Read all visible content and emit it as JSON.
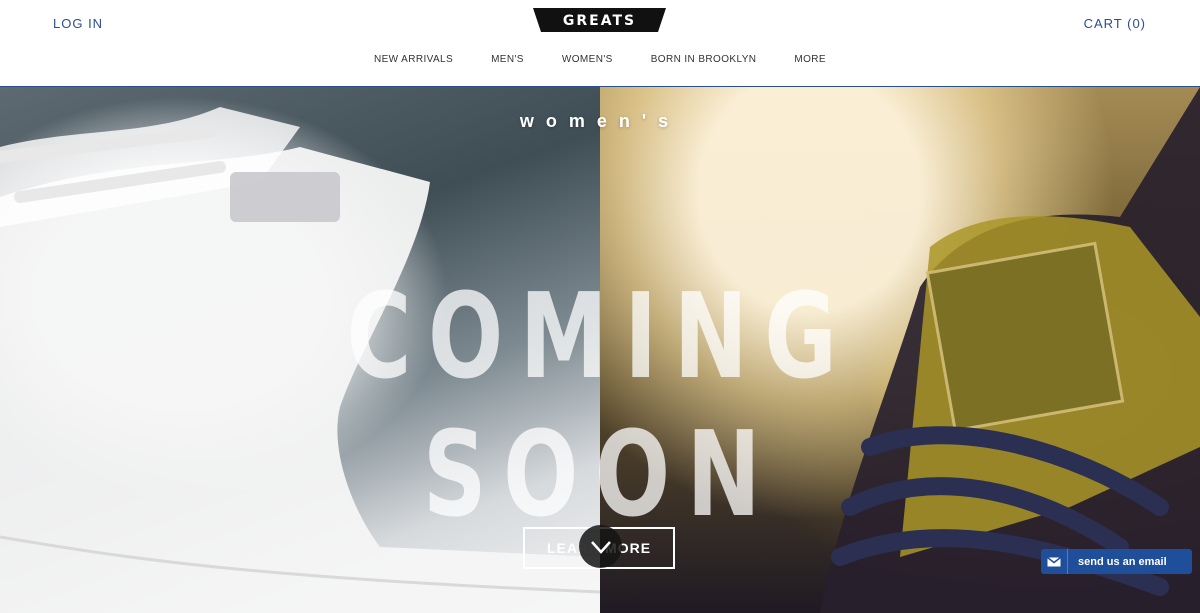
{
  "header": {
    "login_label": "LOG IN",
    "cart_label": "CART (0)",
    "logo_text": "GREATS"
  },
  "nav": {
    "items": [
      {
        "label": "NEW ARRIVALS"
      },
      {
        "label": "MEN'S"
      },
      {
        "label": "WOMEN'S"
      },
      {
        "label": "BORN IN BROOKLYN"
      },
      {
        "label": "MORE"
      }
    ]
  },
  "hero": {
    "kicker": "women's",
    "headline": "COMING SOON",
    "cta_label": "LEARN MORE"
  },
  "widgets": {
    "email_label": "send us an email"
  },
  "colors": {
    "brand_blue": "#2b4f8c",
    "email_button": "#1f4f9a"
  },
  "icons": {
    "scroll": "chevron-down-icon",
    "email": "envelope-icon"
  }
}
